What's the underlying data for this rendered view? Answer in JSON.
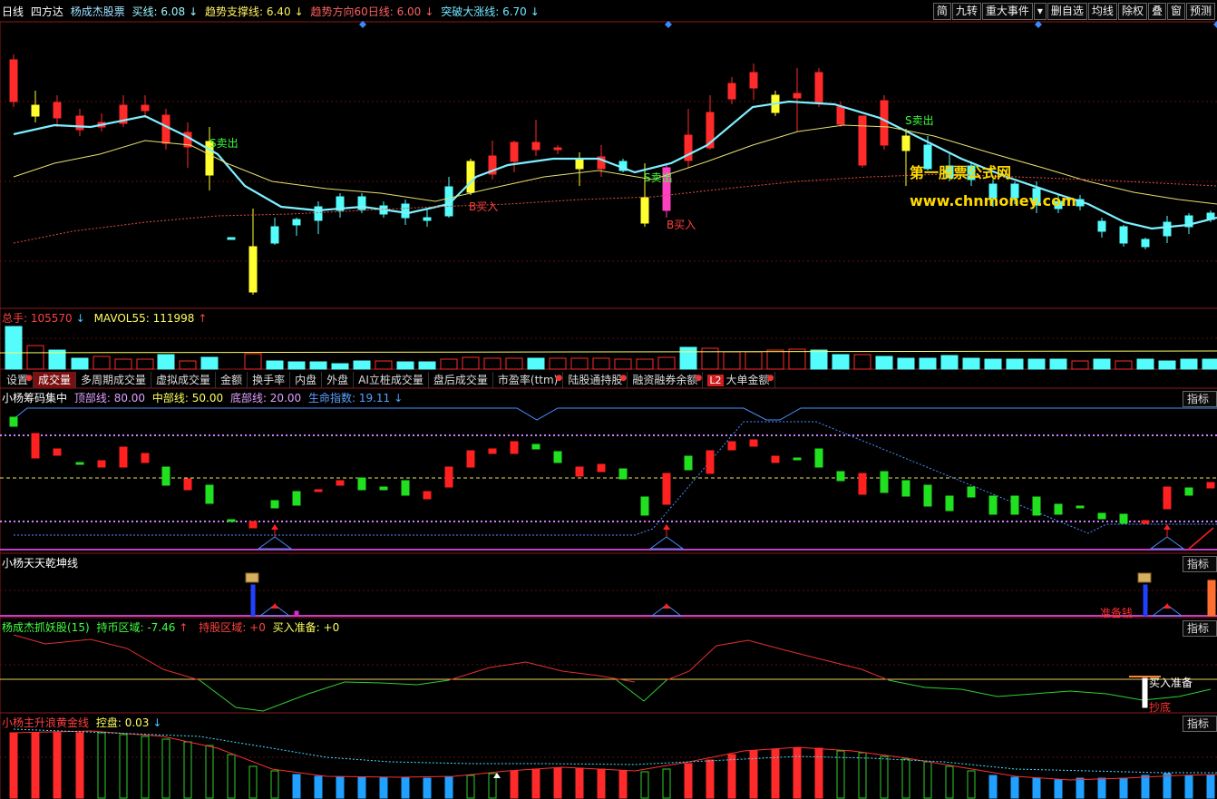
{
  "header": {
    "period": "日线",
    "stock_name": "四方达",
    "indicator_name": "杨成杰股票",
    "buy_line": "买线: 6.08",
    "buy_line_arrow": "↓",
    "support_line": "趋势支撑线: 6.40",
    "support_arrow": "↓",
    "trend_line": "趋势方向60日线: 6.00",
    "trend_arrow": "↓",
    "break_line": "突破大涨线: 6.70",
    "break_arrow": "↓"
  },
  "toolbar": {
    "buttons": [
      "简",
      "九转",
      "重大事件",
      "▾",
      "删自选",
      "均线",
      "除权",
      "叠",
      "窗",
      "预测"
    ]
  },
  "watermark": {
    "line1": "第一股票公式网",
    "line2": "www.chnmoney.com"
  },
  "chart_labels": {
    "sell1": "S卖出",
    "sell2": "S卖出",
    "sell3": "S卖出",
    "buy1": "B买入",
    "buy2": "B买入"
  },
  "volume": {
    "total": "总手: 105570",
    "total_arrow": "↓",
    "mavol": "MAVOL55: 111998",
    "mavol_arrow": "↑"
  },
  "tabs": [
    {
      "label": "设置",
      "dot": true
    },
    {
      "label": "成交量",
      "active": true
    },
    {
      "label": "多周期成交量"
    },
    {
      "label": "虚拟成交量"
    },
    {
      "label": "金额"
    },
    {
      "label": "换手率"
    },
    {
      "label": "内盘"
    },
    {
      "label": "外盘"
    },
    {
      "label": "AI立桩成交量"
    },
    {
      "label": "盘后成交量"
    },
    {
      "label": "市盈率(ttm)",
      "dot": true
    },
    {
      "label": "陆股通持股",
      "dot": true
    },
    {
      "label": "融资融券余额",
      "dot": true
    },
    {
      "label": "大单金额",
      "badge": "L2",
      "dot": true
    }
  ],
  "panel1": {
    "title": "小杨筹码集中",
    "top": "顶部线: 80.00",
    "mid": "中部线: 50.00",
    "bottom": "底部线: 20.00",
    "life": "生命指数: 19.11",
    "life_arrow": "↓",
    "button": "指标说明"
  },
  "panel2": {
    "title": "小杨天天乾坤线",
    "button": "指标说明",
    "label_ready": "准备钱"
  },
  "panel3": {
    "title": "杨成杰抓妖股(15)",
    "hold_coin": "持币区域: -7.46",
    "hold_coin_arrow": "↑",
    "hold_stock": "持股区域: +0",
    "buy_ready": "买入准备: +0",
    "button": "指标说明",
    "label_buy_ready": "买入准备",
    "label_bottom": "抄底"
  },
  "panel4": {
    "title": "小杨主升浪黄金线",
    "control": "控盘: 0.03",
    "control_arrow": "↓",
    "button": "指标说明"
  },
  "colors": {
    "up": "#ff2a2a",
    "down": "#54fcfc",
    "ma_fast": "#7ef0ff",
    "ma_slow": "#e8e070",
    "grid": "#7a1a1a",
    "yellow_candle": "#ffff30",
    "magenta_candle": "#ff40c0",
    "chip_green": "#20e020",
    "chip_red": "#ff2020",
    "violet": "#d080ff",
    "blue_line": "#4a90ff",
    "gold": "#e8d060"
  }
}
